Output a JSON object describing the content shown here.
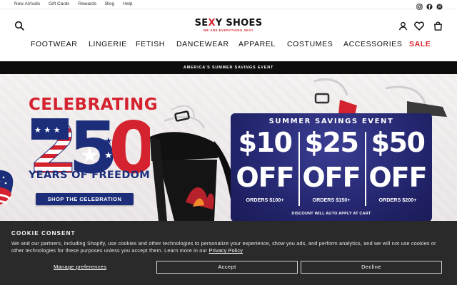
{
  "utility_bar": {
    "links": [
      "New Arrivals",
      "Gift Cards",
      "Rewards",
      "Blog",
      "Help"
    ],
    "social_icons": [
      "instagram-icon",
      "facebook-icon",
      "pinterest-icon"
    ]
  },
  "header": {
    "logo_main_a": "SE",
    "logo_main_x": "X",
    "logo_main_b": "Y SHOES",
    "logo_tagline": "WE ARE EVERYTHING SEXY",
    "icons": [
      "search-icon",
      "account-icon",
      "wishlist-icon",
      "cart-icon"
    ]
  },
  "nav": {
    "items": [
      "FOOTWEAR",
      "LINGERIE",
      "FETISH",
      "DANCEWEAR",
      "APPAREL",
      "COSTUMES",
      "ACCESSORIES",
      "SALE"
    ]
  },
  "promo_strip": {
    "text": "AMERICA'S SUMMER SAVINGS EVENT"
  },
  "hero": {
    "celebrating": "CELEBRATING",
    "big_number": "250",
    "freedom": "YEARS OF FREEDOM",
    "cta": "SHOP THE CELEBRATION",
    "deal": {
      "title": "SUMMER SAVINGS EVENT",
      "tiers": [
        {
          "amount": "$10",
          "off": "OFF",
          "minimum": "ORDERS $100+"
        },
        {
          "amount": "$25",
          "off": "OFF",
          "minimum": "ORDERS $150+"
        },
        {
          "amount": "$50",
          "off": "OFF",
          "minimum": "ORDERS $200+"
        }
      ],
      "note": "DISCOUNT WILL AUTO APPLY AT CART"
    },
    "colors": {
      "red": "#d4232f",
      "navy": "#1c2e7a",
      "card": "#24266f"
    }
  },
  "cookie": {
    "title": "COOKIE CONSENT",
    "text": "We and our partners, including Shopify, use cookies and other technologies to personalize your experience, show you ads, and perform analytics, and we will not use cookies or other technologies for these purposes unless you accept them. Learn more in our",
    "policy_link": "Privacy Policy",
    "manage": "Manage preferences",
    "accept": "Accept",
    "decline": "Decline"
  }
}
